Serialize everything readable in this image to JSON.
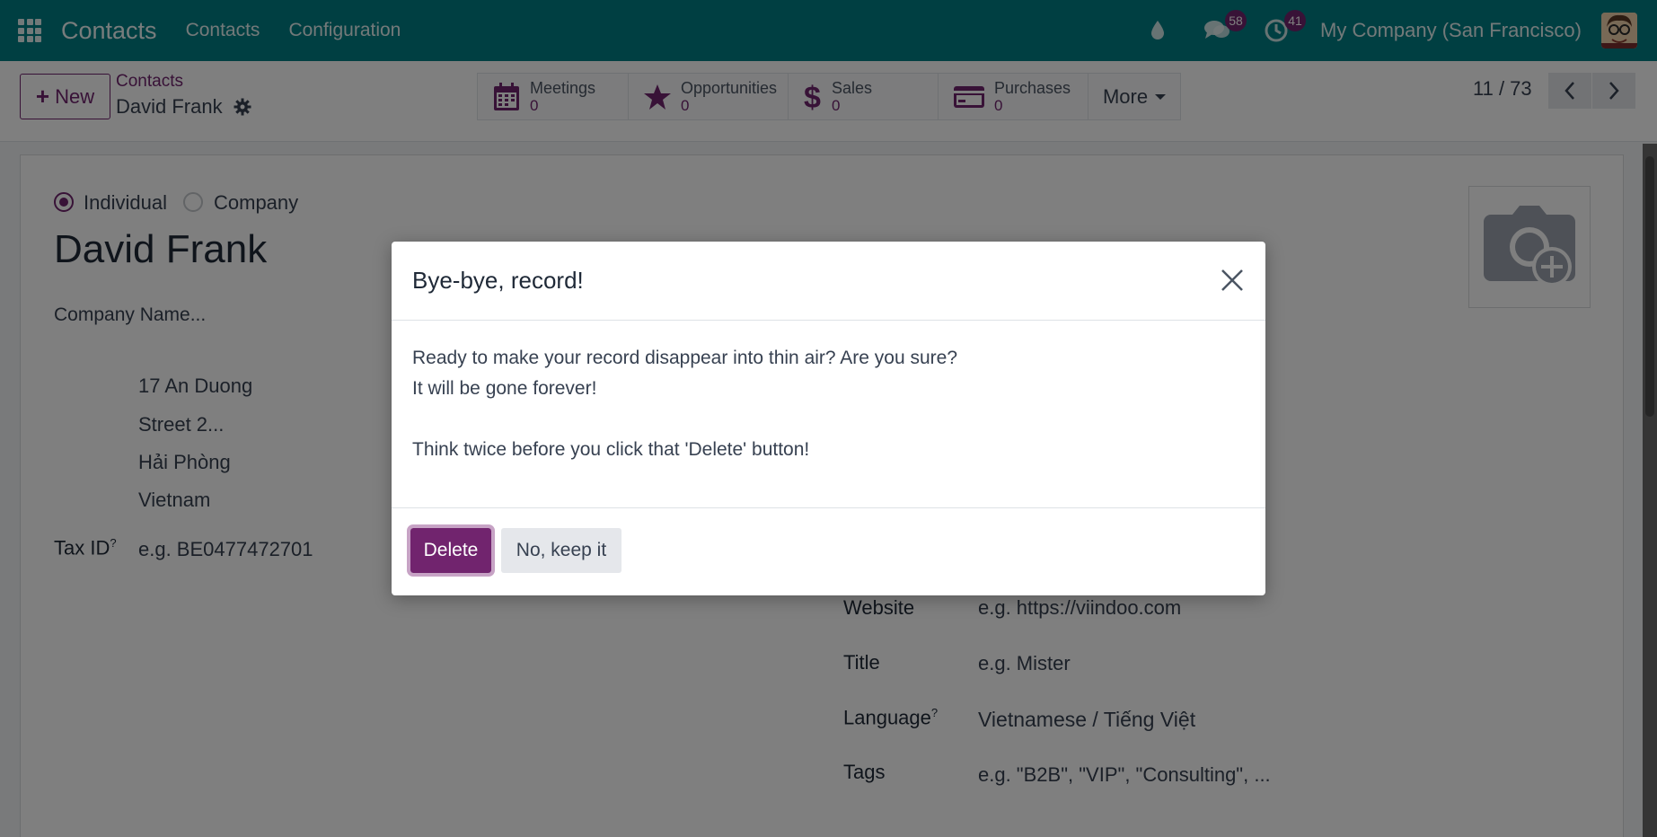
{
  "navbar": {
    "brand": "Contacts",
    "links": [
      "Contacts",
      "Configuration"
    ],
    "messages_count": "58",
    "activities_count": "41",
    "company": "My Company (San Francisco)"
  },
  "control": {
    "new_label": "New",
    "breadcrumb_parent": "Contacts",
    "breadcrumb_current": "David Frank",
    "smart_buttons": [
      {
        "label": "Meetings",
        "value": "0"
      },
      {
        "label": "Opportunities",
        "value": "0"
      },
      {
        "label": "Sales",
        "value": "0"
      },
      {
        "label": "Purchases",
        "value": "0"
      }
    ],
    "more_label": "More",
    "pager": "11 / 73"
  },
  "form": {
    "type_individual": "Individual",
    "type_company": "Company",
    "name": "David Frank",
    "company_placeholder": "Company Name...",
    "street": "17 An Duong",
    "street2_placeholder": "Street 2...",
    "city": "Hải Phòng",
    "country": "Vietnam",
    "tax_label": "Tax ID",
    "tax_placeholder": "e.g. BE0477472701",
    "website_label": "Website",
    "website_placeholder": "e.g. https://viindoo.com",
    "title_label": "Title",
    "title_placeholder": "e.g. Mister",
    "language_label": "Language",
    "language_value": "Vietnamese / Tiếng Việt",
    "tags_label": "Tags",
    "tags_placeholder": "e.g. \"B2B\", \"VIP\", \"Consulting\", ..."
  },
  "dialog": {
    "title": "Bye-bye, record!",
    "line1": "Ready to make your record disappear into thin air? Are you sure?",
    "line2": "It will be gone forever!",
    "line3": "Think twice before you click that 'Delete' button!",
    "delete_label": "Delete",
    "keep_label": "No, keep it"
  },
  "colors": {
    "navbar": "#017e84",
    "primary": "#71246e"
  }
}
